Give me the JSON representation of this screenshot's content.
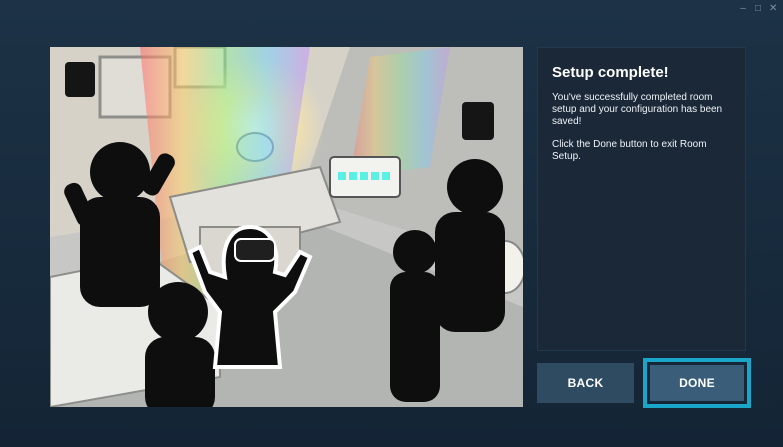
{
  "window": {
    "controls": {
      "minimize": "–",
      "maximize": "□",
      "close": "✕"
    }
  },
  "illustration": {
    "description_icon": "room-setup-illustration"
  },
  "info": {
    "title": "Setup complete!",
    "paragraphs": [
      "You've successfully completed room setup and your configuration has been saved!",
      "Click the Done button to exit Room Setup."
    ]
  },
  "buttons": {
    "back_label": "BACK",
    "done_label": "DONE"
  },
  "colors": {
    "accent_outline": "#1aa6c8",
    "button_back": "#2f4b62",
    "button_done": "#3a5d7a",
    "panel_bg": "#1b2838"
  }
}
